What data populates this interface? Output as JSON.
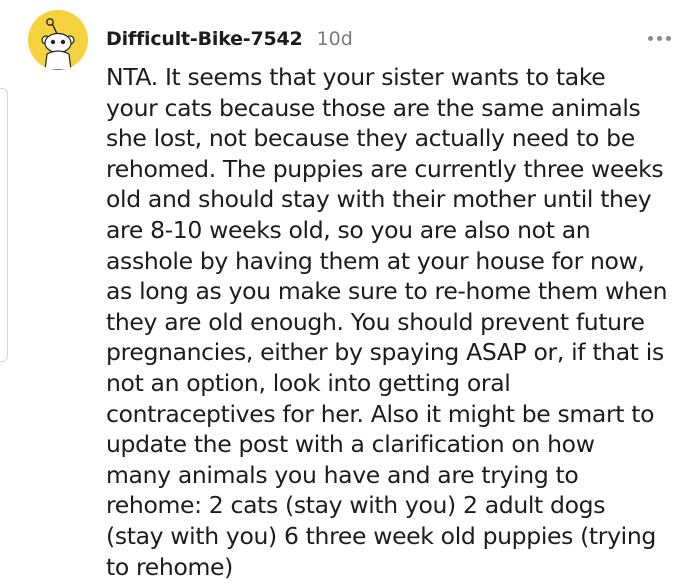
{
  "comment": {
    "author": "Difficult-Bike-7542",
    "age": "10d",
    "avatar_icon": "snoo-avatar-icon",
    "avatar_color": "#f4d33f",
    "more_icon": "more-options-icon",
    "body_lines": [
      "NTA. It seems that your sister wants to take",
      "your cats because those are the same animals",
      "she lost, not because they actually need to be",
      "rehomed. The puppies are currently three weeks",
      "old and should stay with their mother until they",
      "are 8-10 weeks old, so you are also not an",
      "asshole by having them at your house for now,",
      "as long as you make sure to re-home them when",
      "they are old enough. You should prevent future",
      "pregnancies, either by spaying ASAP or, if that is",
      "not an option, look into getting oral",
      "contraceptives for her. Also it might be smart to",
      "update the post with a clarification on how",
      "many animals you have and are trying to",
      "rehome: 2 cats (stay with you) 2 adult dogs",
      "(stay with you) 6 three week old puppies (trying",
      "to rehome)"
    ]
  }
}
